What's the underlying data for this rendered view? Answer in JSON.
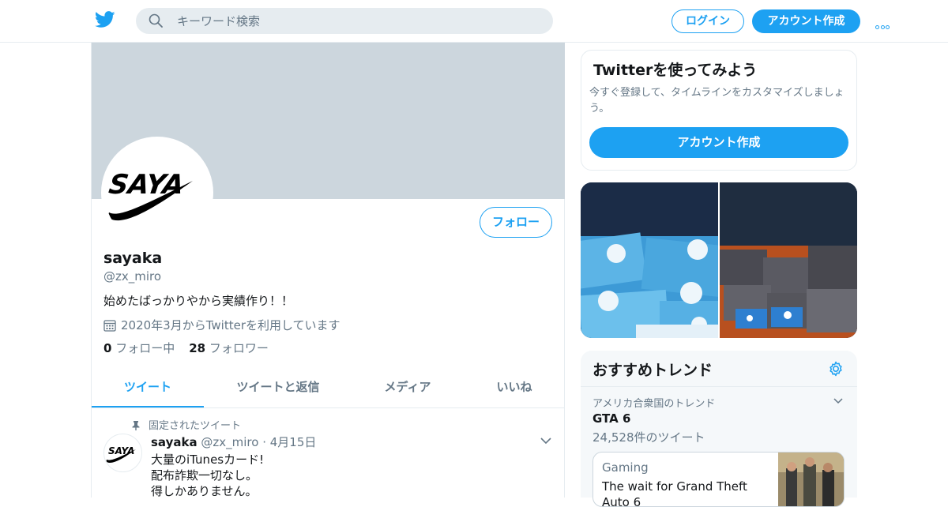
{
  "header": {
    "search_placeholder": "キーワード検索",
    "login_label": "ログイン",
    "signup_label": "アカウント作成"
  },
  "profile": {
    "avatar_text": "SAYA",
    "follow_label": "フォロー",
    "name": "sayaka",
    "handle": "@zx_miro",
    "bio": "始めたばっかりやから実績作り！！",
    "joined": "2020年3月からTwitterを利用しています",
    "following_count": "0",
    "following_label": "フォロー中",
    "followers_count": "28",
    "followers_label": "フォロワー"
  },
  "tabs": [
    {
      "label": "ツイート"
    },
    {
      "label": "ツイートと返信"
    },
    {
      "label": "メディア"
    },
    {
      "label": "いいね"
    }
  ],
  "pinned_tweet": {
    "pinned_label": "固定されたツイート",
    "name": "sayaka",
    "handle": "@zx_miro",
    "date": "· 4月15日",
    "lines": [
      "大量のiTunesカード!",
      "配布詐欺一切なし。",
      "得しかありません。"
    ]
  },
  "signup_card": {
    "title": "Twitterを使ってみよう",
    "description": "今すぐ登録して、タイムラインをカスタマイズしましょう。",
    "button_label": "アカウント作成"
  },
  "trends": {
    "title": "おすすめトレンド",
    "context": "アメリカ合衆国のトレンド",
    "topic": "GTA 6",
    "count": "24,528件のツイート",
    "card_category": "Gaming",
    "card_text": "The wait for Grand Theft Auto 6"
  },
  "colors": {
    "accent": "#1da1f2",
    "banner": "#ccd6dd",
    "muted_text": "#657786",
    "border": "#e6ecf0"
  }
}
